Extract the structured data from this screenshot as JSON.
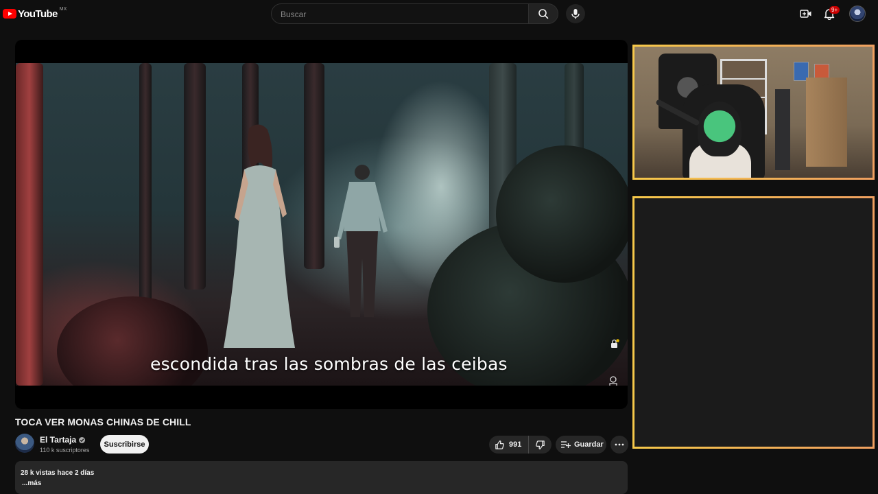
{
  "header": {
    "logo_text": "YouTube",
    "region": "MX",
    "search_placeholder": "Buscar",
    "notifications_badge": "9+"
  },
  "player": {
    "caption": "escondida tras las sombras de las ceibas"
  },
  "video": {
    "title": "TOCA VER MONAS CHINAS DE CHILL",
    "channel_name": "El Tartaja",
    "subscribers": "110 k suscriptores",
    "subscribe_label": "Suscribirse",
    "likes": "991",
    "save_label": "Guardar",
    "views_date": "28 k vistas  hace 2 días",
    "more_label": "...más"
  },
  "colors": {
    "background": "#0f0f0f",
    "accent_red": "#ff0000",
    "overlay_border_start": "#f6c84a",
    "overlay_border_end": "#f0a060"
  },
  "icons": {
    "search": "search-icon",
    "mic": "mic-icon",
    "create": "create-video-icon",
    "notifications": "bell-icon",
    "like": "thumbs-up-icon",
    "dislike": "thumbs-down-icon",
    "save": "playlist-add-icon",
    "more": "more-horizontal-icon"
  }
}
